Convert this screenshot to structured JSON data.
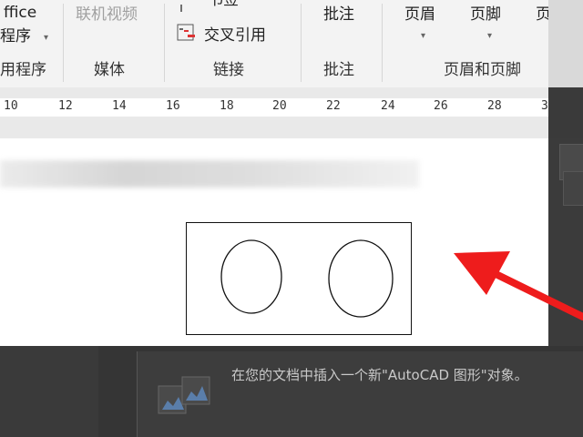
{
  "ribbon": {
    "office_btn": {
      "line1": "ffice",
      "line2": "程序"
    },
    "online_video": "联机视频",
    "bookmark": "书签",
    "cross_ref": "交叉引用",
    "comment_btn": "批注",
    "header_btn": "页眉",
    "footer_btn": "页脚",
    "page_num_btn": "页",
    "groups": {
      "apps": "用程序",
      "media": "媒体",
      "links": "链接",
      "comments": "批注",
      "header_footer": "页眉和页脚"
    }
  },
  "ruler": {
    "ticks": [
      "10",
      "12",
      "14",
      "16",
      "18",
      "20",
      "22",
      "24",
      "26",
      "28",
      "3"
    ]
  },
  "dialog": {
    "description": "在您的文档中插入一个新\"AutoCAD 图形\"对象。"
  },
  "colors": {
    "arrow": "#ee1c1c",
    "ribbon_bg": "#f3f3f3",
    "page_bg": "#ffffff",
    "dark_bg": "#3a3a3a"
  },
  "icons": [
    "cross-reference-icon",
    "bookmark-icon",
    "chevron-down-icon",
    "drawing-object-icon",
    "red-arrow-annotation"
  ]
}
